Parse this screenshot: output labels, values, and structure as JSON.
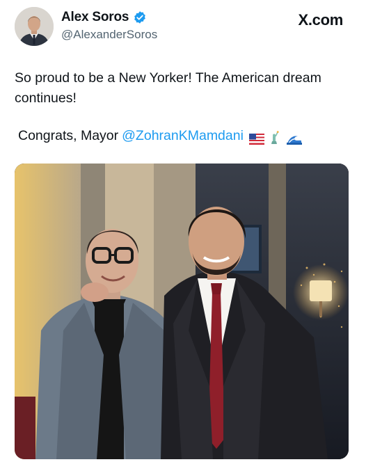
{
  "header": {
    "display_name": "Alex Soros",
    "handle": "@AlexanderSoros",
    "brand": "X.com",
    "avatar_icon": "profile-photo",
    "verified_icon": "verified-badge-icon",
    "verified_color": "#1d9bf0"
  },
  "tweet": {
    "text": "So proud to be a New Yorker! The American dream continues!",
    "congrats_prefix": "Congrats, Mayor",
    "mention": "@ZohranKMamdani",
    "emoji_icons": [
      "us-flag-icon",
      "statue-of-liberty-icon",
      "wave-icon"
    ],
    "mention_color": "#1d9bf0"
  },
  "photo": {
    "description_icon": "two-men-posing-photo"
  }
}
